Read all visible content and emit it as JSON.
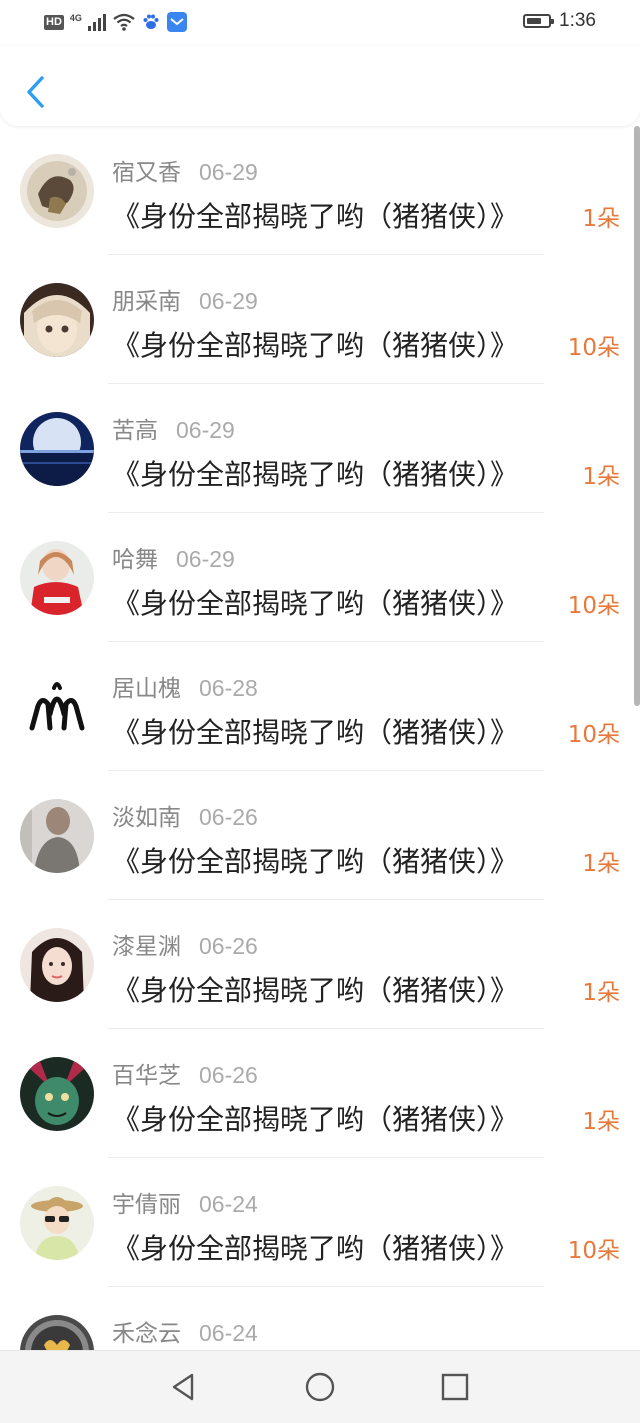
{
  "status_bar": {
    "hd": "HD",
    "network": "4G",
    "time": "1:36",
    "battery_level": 0.7
  },
  "header": {
    "back_icon": "chevron-left-icon",
    "accent_color": "#2d9ef0"
  },
  "gifts": [
    {
      "name": "宿又香",
      "date": "06-29",
      "title": "《身份全部揭晓了哟（猪猪侠）》",
      "flowers": "1朵"
    },
    {
      "name": "朋采南",
      "date": "06-29",
      "title": "《身份全部揭晓了哟（猪猪侠）》",
      "flowers": "10朵"
    },
    {
      "name": "苦高",
      "date": "06-29",
      "title": "《身份全部揭晓了哟（猪猪侠）》",
      "flowers": "1朵"
    },
    {
      "name": "哈舞",
      "date": "06-29",
      "title": "《身份全部揭晓了哟（猪猪侠）》",
      "flowers": "10朵"
    },
    {
      "name": "居山槐",
      "date": "06-28",
      "title": "《身份全部揭晓了哟（猪猪侠）》",
      "flowers": "10朵"
    },
    {
      "name": "淡如南",
      "date": "06-26",
      "title": "《身份全部揭晓了哟（猪猪侠）》",
      "flowers": "1朵"
    },
    {
      "name": "漆星渊",
      "date": "06-26",
      "title": "《身份全部揭晓了哟（猪猪侠）》",
      "flowers": "1朵"
    },
    {
      "name": "百华芝",
      "date": "06-26",
      "title": "《身份全部揭晓了哟（猪猪侠）》",
      "flowers": "1朵"
    },
    {
      "name": "宇倩丽",
      "date": "06-24",
      "title": "《身份全部揭晓了哟（猪猪侠）》",
      "flowers": "10朵"
    },
    {
      "name": "禾念云",
      "date": "06-24",
      "title": "",
      "flowers": ""
    }
  ],
  "nav": {
    "back": "triangle-back-icon",
    "home": "circle-home-icon",
    "recents": "square-recents-icon"
  },
  "colors": {
    "flower_count": "#e8793a",
    "name": "#888888",
    "title": "#222222"
  }
}
